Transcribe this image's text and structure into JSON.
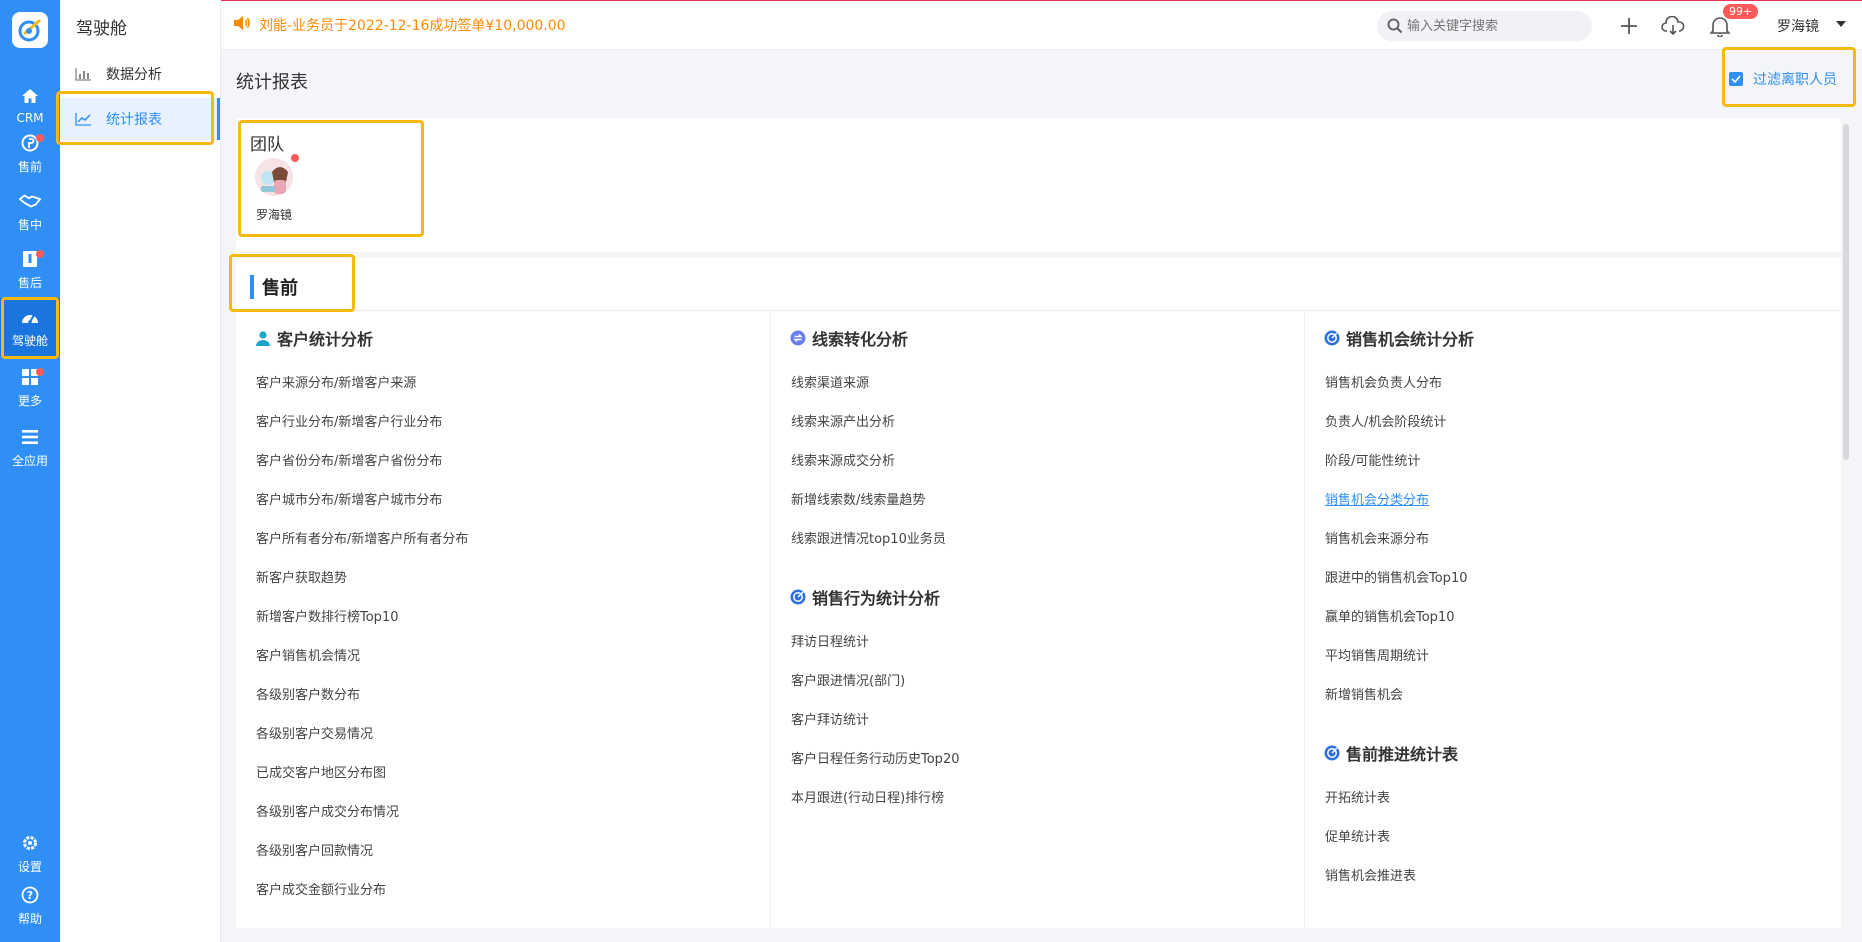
{
  "rail": {
    "items": [
      {
        "label": "CRM",
        "icon": "home-icon",
        "dot": false
      },
      {
        "label": "售前",
        "icon": "pin-icon",
        "dot": true
      },
      {
        "label": "售中",
        "icon": "handshake-icon",
        "dot": false
      },
      {
        "label": "售后",
        "icon": "service-icon",
        "dot": true
      },
      {
        "label": "驾驶舱",
        "icon": "dashboard-icon",
        "dot": false,
        "active": true
      },
      {
        "label": "更多",
        "icon": "grid-icon",
        "dot": true
      },
      {
        "label": "全应用",
        "icon": "menu-icon",
        "dot": false
      }
    ],
    "bottom": [
      {
        "label": "设置",
        "icon": "gear-icon"
      },
      {
        "label": "帮助",
        "icon": "help-icon"
      }
    ]
  },
  "sidebar": {
    "title": "驾驶舱",
    "items": [
      {
        "label": "数据分析",
        "icon": "bar-chart-icon",
        "active": false
      },
      {
        "label": "统计报表",
        "icon": "line-chart-icon",
        "active": true
      }
    ]
  },
  "topbar": {
    "notice": "刘能-业务员于2022-12-16成功签单¥10,000.00",
    "search_placeholder": "输入关键字搜索",
    "badge": "99+",
    "user": "罗海镜"
  },
  "page": {
    "title": "统计报表",
    "filter_label": "过滤离职人员",
    "filter_checked": true
  },
  "team": {
    "title": "团队",
    "members": [
      "罗海镜"
    ]
  },
  "section": {
    "title": "售前",
    "columns": [
      {
        "groups": [
          {
            "title": "客户统计分析",
            "icon": "user-icon",
            "links": [
              "客户来源分布/新增客户来源",
              "客户行业分布/新增客户行业分布",
              "客户省份分布/新增客户省份分布",
              "客户城市分布/新增客户城市分布",
              "客户所有者分布/新增客户所有者分布",
              "新客户获取趋势",
              "新增客户数排行榜Top10",
              "客户销售机会情况",
              "各级别客户数分布",
              "各级别客户交易情况",
              "已成交客户地区分布图",
              "各级别客户成交分布情况",
              "各级别客户回款情况",
              "客户成交金额行业分布"
            ]
          }
        ]
      },
      {
        "groups": [
          {
            "title": "线索转化分析",
            "icon": "convert-icon",
            "links": [
              "线索渠道来源",
              "线索来源产出分析",
              "线索来源成交分析",
              "新增线索数/线索量趋势",
              "线索跟进情况top10业务员"
            ]
          },
          {
            "title": "销售行为统计分析",
            "icon": "target-icon",
            "links": [
              "拜访日程统计",
              "客户跟进情况(部门)",
              "客户拜访统计",
              "客户日程任务行动历史Top20",
              "本月跟进(行动日程)排行榜"
            ]
          }
        ]
      },
      {
        "groups": [
          {
            "title": "销售机会统计分析",
            "icon": "target-icon",
            "links": [
              "销售机会负责人分布",
              "负责人/机会阶段统计",
              "阶段/可能性统计",
              "销售机会分类分布",
              "销售机会来源分布",
              "跟进中的销售机会Top10",
              "赢单的销售机会Top10",
              "平均销售周期统计",
              "新增销售机会"
            ]
          },
          {
            "title": "售前推进统计表",
            "icon": "target-icon",
            "links": [
              "开拓统计表",
              "促单统计表",
              "销售机会推进表"
            ]
          }
        ]
      }
    ],
    "highlighted_link": "销售机会分类分布"
  },
  "colors": {
    "primary": "#2f8ff5",
    "notice": "#ff8a00",
    "badge": "#ff5a5a",
    "highlight": "#f5b90f"
  }
}
